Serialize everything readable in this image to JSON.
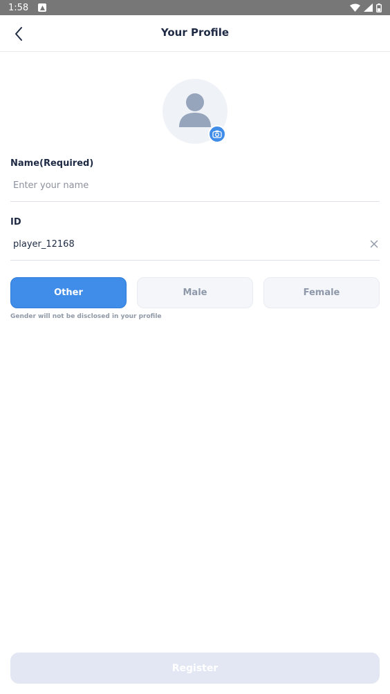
{
  "status_bar": {
    "time": "1:58"
  },
  "header": {
    "title": "Your Profile"
  },
  "name_field": {
    "label": "Name(Required)",
    "placeholder": "Enter your name",
    "value": ""
  },
  "id_field": {
    "label": "ID",
    "value": "player_12168"
  },
  "gender": {
    "options": [
      "Other",
      "Male",
      "Female"
    ],
    "selected": "Other",
    "note": "Gender will not be disclosed in your profile"
  },
  "register": {
    "label": "Register"
  },
  "colors": {
    "accent": "#3f8de9",
    "title_text": "#1e2a44",
    "disabled_button": "#e2e7f3"
  },
  "icons": {
    "back": "chevron-left-icon",
    "avatar": "person-icon",
    "camera": "camera-icon",
    "clear": "close-icon"
  }
}
